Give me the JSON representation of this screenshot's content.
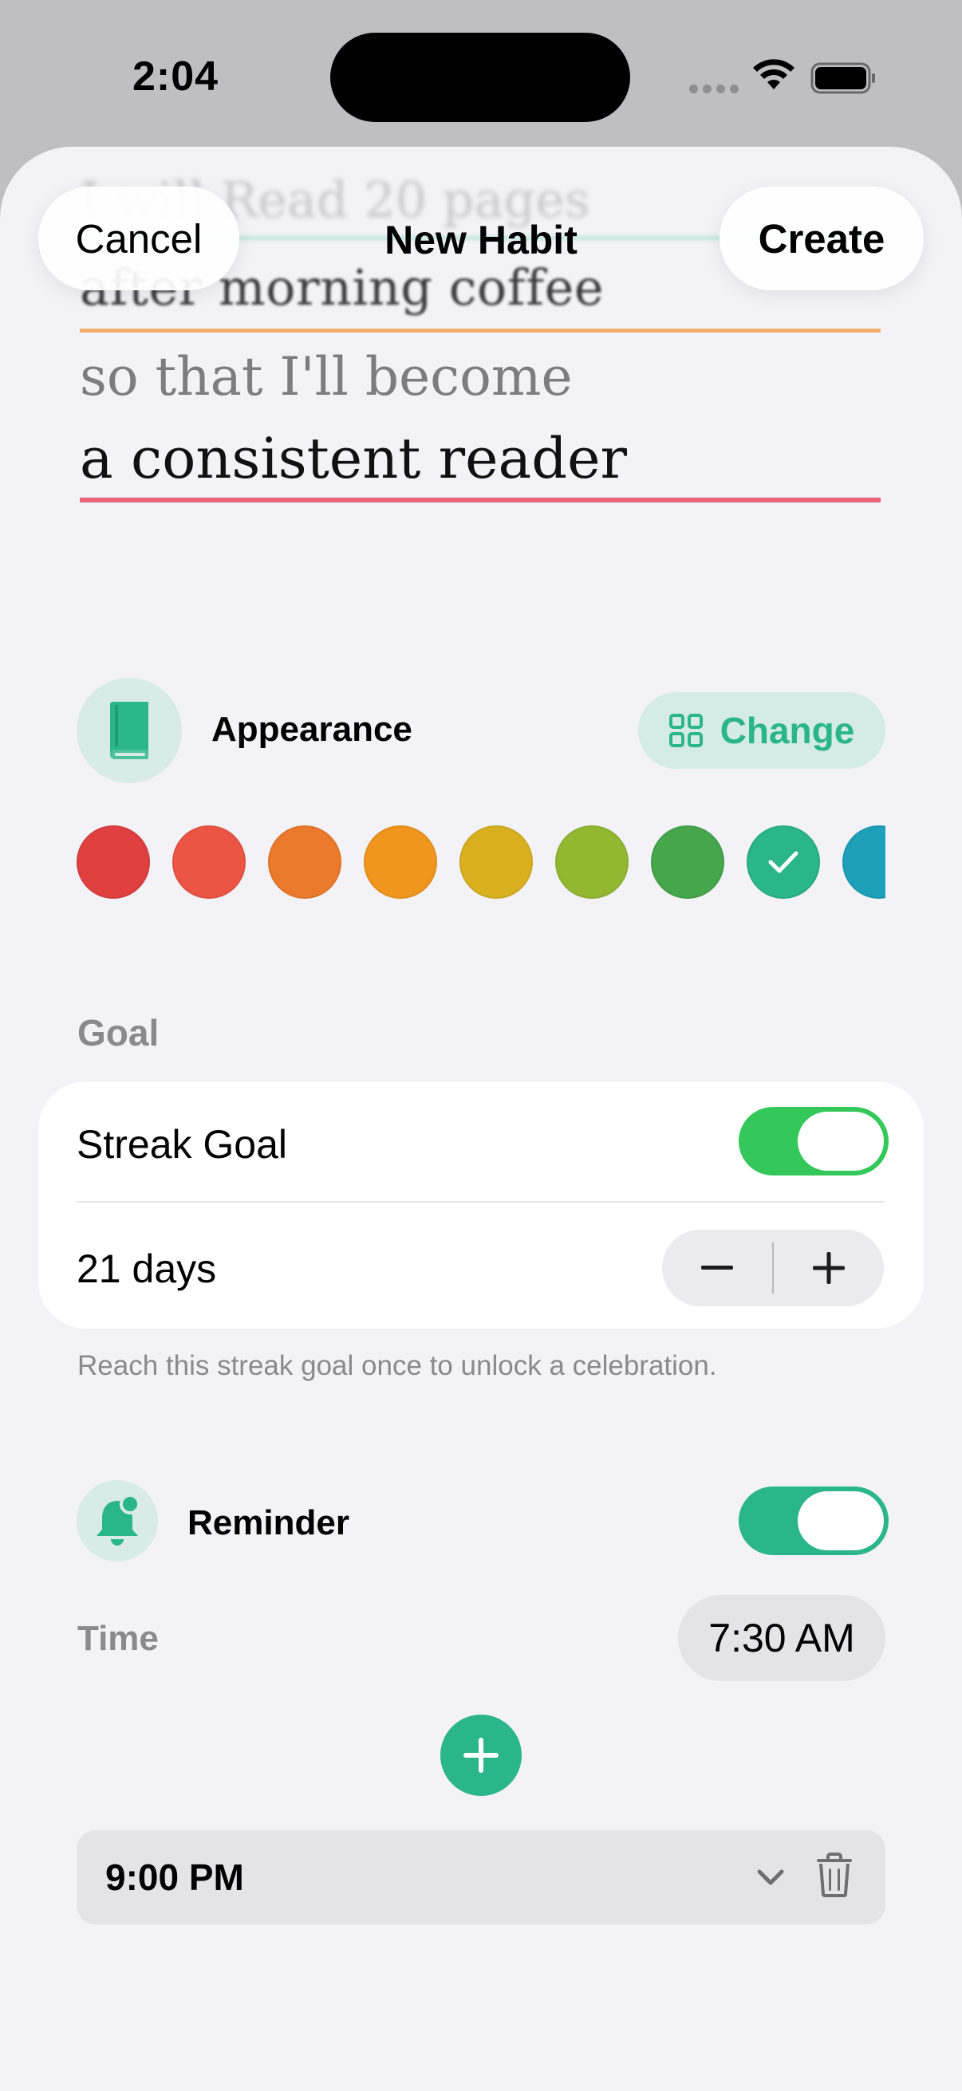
{
  "status": {
    "time": "2:04"
  },
  "form": {
    "ghost_line": "I will Read 20 pages",
    "when_text": "after morning coffee",
    "sothat_text": "so that I'll become",
    "identity_text": "a consistent reader"
  },
  "nav": {
    "cancel_label": "Cancel",
    "title": "New Habit",
    "create_label": "Create"
  },
  "appearance": {
    "label": "Appearance",
    "change_label": "Change",
    "icon": "book-icon",
    "accent_color": "#2bb58a",
    "colors": [
      "#e04040",
      "#ec5544",
      "#ec7a2c",
      "#f0961e",
      "#d8b020",
      "#92b832",
      "#46a64c",
      "#2bb58a",
      "#1ea0b8"
    ],
    "selected_index": 7
  },
  "goal": {
    "section_label": "Goal",
    "streak_label": "Streak Goal",
    "streak_enabled": true,
    "days_value": "21 days",
    "footnote": "Reach this streak goal once to unlock a celebration."
  },
  "reminder": {
    "label": "Reminder",
    "enabled": true,
    "time_label": "Time",
    "time_value": "7:30 AM",
    "extra_times": [
      "9:00 PM"
    ]
  }
}
